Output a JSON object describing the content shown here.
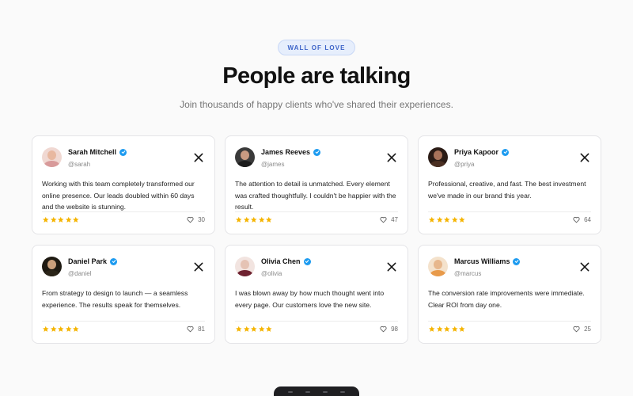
{
  "header": {
    "badge": "WALL OF LOVE",
    "title": "People are talking",
    "subtitle": "Join thousands of happy clients who've shared their experiences."
  },
  "colors": {
    "accent": "#1d9bf0",
    "star": "#f5b400",
    "badge_text": "#3d64c8"
  },
  "testimonials": [
    {
      "name": "Sarah Mitchell",
      "handle": "@sarah",
      "quote": "Working with this team completely transformed our online presence. Our leads doubled within 60 days and the website is stunning.",
      "rating": 5,
      "likes": "30",
      "avatar": {
        "skin": "#e8b8a0",
        "shirt": "#d89a9a",
        "bg": "#f0d8d2"
      }
    },
    {
      "name": "James Reeves",
      "handle": "@james",
      "quote": "The attention to detail is unmatched. Every element was crafted thoughtfully. I couldn't be happier with the result.",
      "rating": 5,
      "likes": "47",
      "avatar": {
        "skin": "#c89a82",
        "shirt": "#1c1c1c",
        "bg": "#3a3a3a"
      }
    },
    {
      "name": "Priya Kapoor",
      "handle": "@priya",
      "quote": "Professional, creative, and fast. The best investment we've made in our brand this year.",
      "rating": 5,
      "likes": "64",
      "avatar": {
        "skin": "#a9735a",
        "shirt": "#4a2f22",
        "bg": "#2b1c16"
      }
    },
    {
      "name": "Daniel Park",
      "handle": "@daniel",
      "quote": "From strategy to design to launch — a seamless experience. The results speak for themselves.",
      "rating": 5,
      "likes": "81",
      "avatar": {
        "skin": "#caa07c",
        "shirt": "#2a2418",
        "bg": "#1e1a12"
      }
    },
    {
      "name": "Olivia Chen",
      "handle": "@olivia",
      "quote": "I was blown away by how much thought went into every page. Our customers love the new site.",
      "rating": 5,
      "likes": "98",
      "avatar": {
        "skin": "#e5c3b4",
        "shirt": "#6e2230",
        "bg": "#f2e4e0"
      }
    },
    {
      "name": "Marcus Williams",
      "handle": "@marcus",
      "quote": "The conversion rate improvements were immediate. Clear ROI from day one.",
      "rating": 5,
      "likes": "25",
      "avatar": {
        "skin": "#e7b78c",
        "shirt": "#e89a4a",
        "bg": "#f4e2cc"
      }
    }
  ]
}
